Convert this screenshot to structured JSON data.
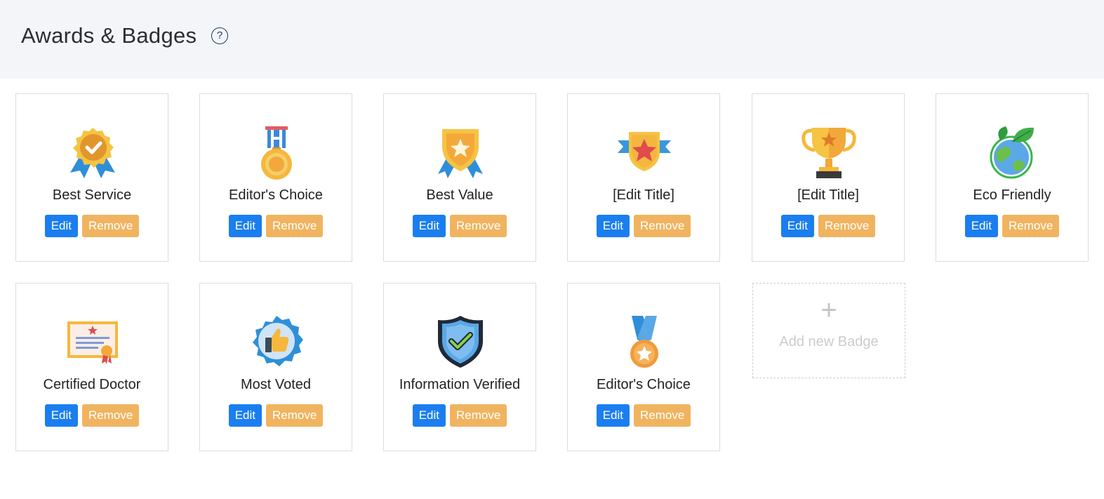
{
  "header": {
    "title": "Awards & Badges",
    "help_icon": "?"
  },
  "badges": [
    {
      "title": "Best Service",
      "icon": "ribbon-check-icon",
      "edit": "Edit",
      "remove": "Remove"
    },
    {
      "title": "Editor's Choice",
      "icon": "medal-icon",
      "edit": "Edit",
      "remove": "Remove"
    },
    {
      "title": "Best Value",
      "icon": "shield-star-ribbon-icon",
      "edit": "Edit",
      "remove": "Remove"
    },
    {
      "title": "[Edit Title]",
      "icon": "star-shield-banner-icon",
      "edit": "Edit",
      "remove": "Remove"
    },
    {
      "title": "[Edit Title]",
      "icon": "trophy-icon",
      "edit": "Edit",
      "remove": "Remove"
    },
    {
      "title": "Eco Friendly",
      "icon": "globe-leaf-icon",
      "edit": "Edit",
      "remove": "Remove"
    },
    {
      "title": "Certified Doctor",
      "icon": "certificate-icon",
      "edit": "Edit",
      "remove": "Remove"
    },
    {
      "title": "Most Voted",
      "icon": "thumbs-up-badge-icon",
      "edit": "Edit",
      "remove": "Remove"
    },
    {
      "title": "Information Verified",
      "icon": "verified-shield-icon",
      "edit": "Edit",
      "remove": "Remove"
    },
    {
      "title": "Editor's Choice",
      "icon": "star-medal-icon",
      "edit": "Edit",
      "remove": "Remove"
    }
  ],
  "add_badge": {
    "plus": "+",
    "label": "Add new Badge"
  },
  "colors": {
    "header_bg": "#f3f5f8",
    "edit_button": "#1a7ef0",
    "remove_button": "#f0b460",
    "card_border": "#dcdcdc"
  }
}
